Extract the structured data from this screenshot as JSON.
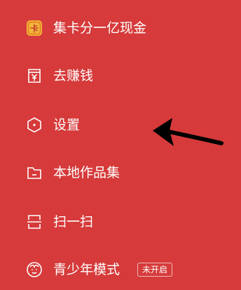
{
  "menu": {
    "items": [
      {
        "label": "集卡分一亿现金",
        "icon": "card-coin-icon"
      },
      {
        "label": "去赚钱",
        "icon": "yuan-voucher-icon"
      },
      {
        "label": "设置",
        "icon": "settings-hexagon-icon"
      },
      {
        "label": "本地作品集",
        "icon": "folder-icon"
      },
      {
        "label": "扫一扫",
        "icon": "scan-icon"
      },
      {
        "label": "青少年模式",
        "icon": "teen-face-icon",
        "badge": "未开启"
      }
    ]
  },
  "colors": {
    "background": "#D63A3A",
    "text": "#FFFFFF",
    "coin": "#F3B53B",
    "arrow": "#000000"
  }
}
